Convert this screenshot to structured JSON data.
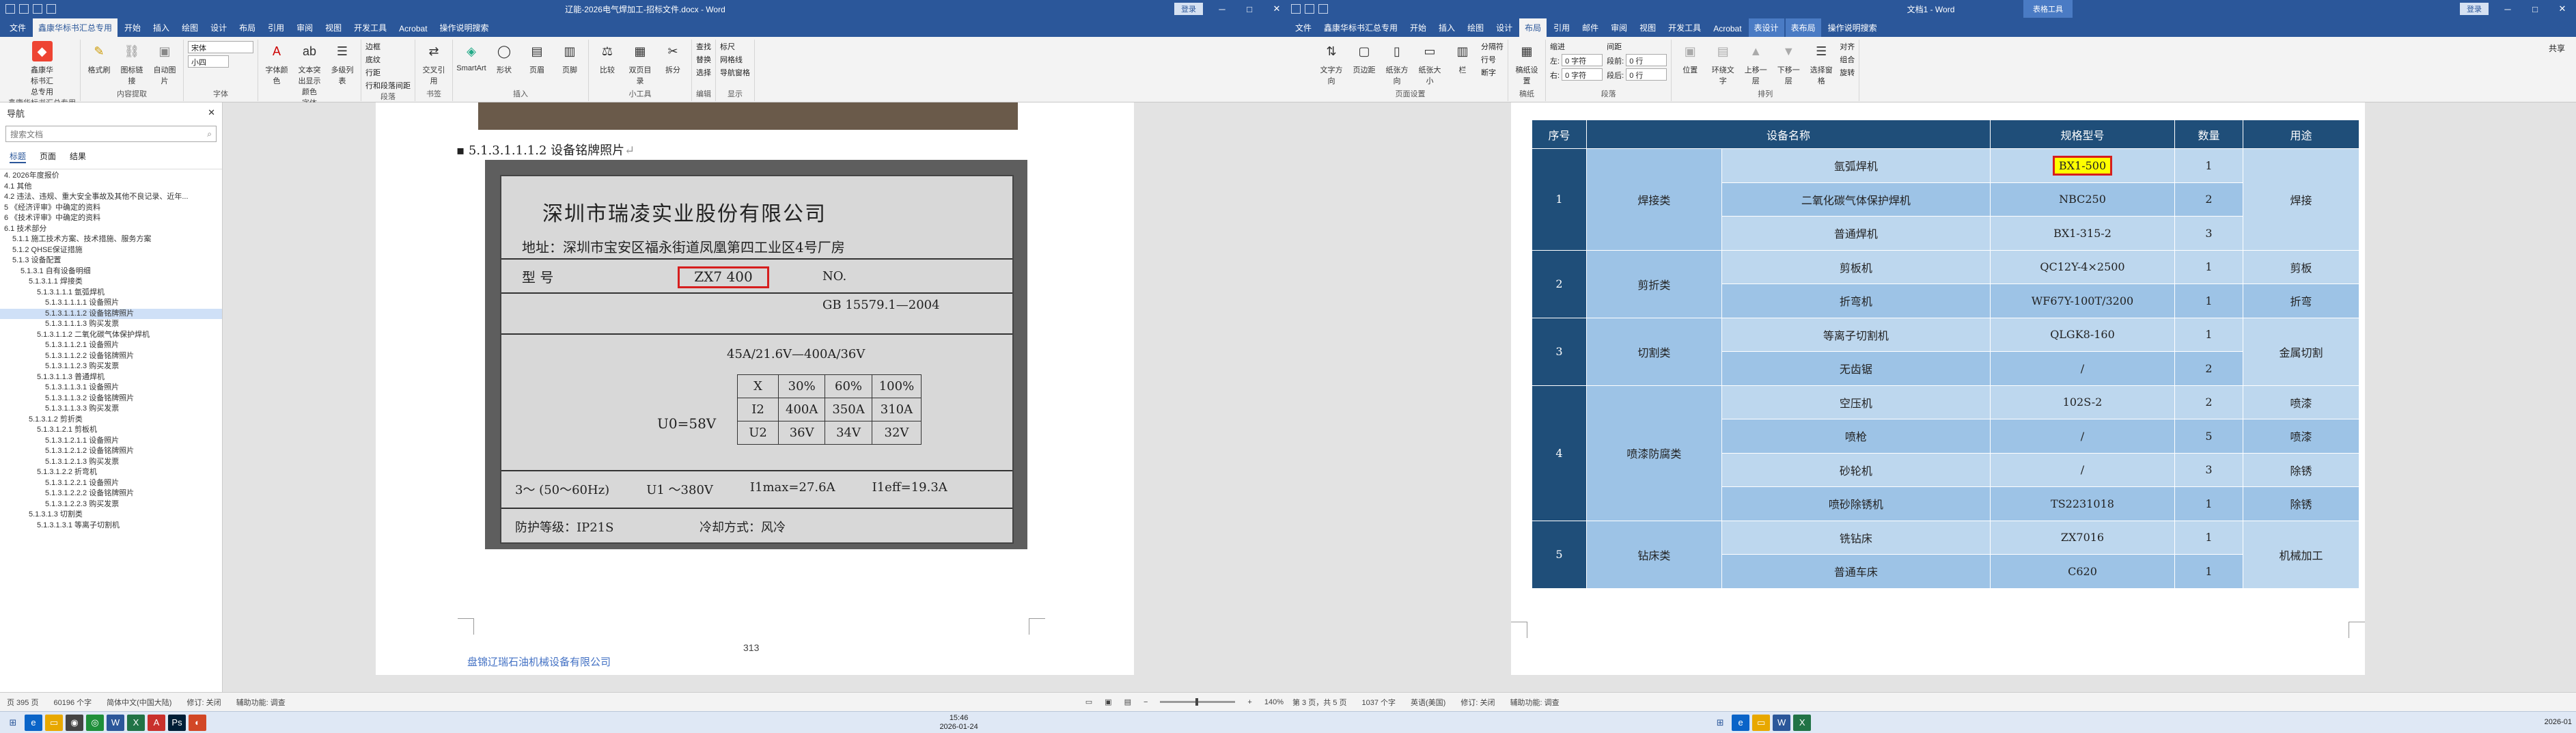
{
  "left_window": {
    "title": "辽能-2026电气焊加工-招标文件.docx - Word",
    "login": "登录",
    "tabs": [
      "文件",
      "鑫康华标书汇总专用",
      "开始",
      "插入",
      "绘图",
      "设计",
      "布局",
      "引用",
      "审阅",
      "视图",
      "开发工具",
      "Acrobat",
      "操作说明搜索"
    ],
    "active_tab": "鑫康华标书汇总专用",
    "ribbon": {
      "groups": [
        {
          "label": "鑫康华标书汇总专用",
          "items": [
            "鑫康华标书汇总专用"
          ]
        },
        {
          "label": "内容提取",
          "items": [
            "格式刷",
            "图标链接",
            "自动图片"
          ]
        },
        {
          "label": "字体",
          "font": "宋体",
          "size": "小四"
        },
        {
          "label": "字体",
          "items": [
            "字体颜色",
            "文本突出显示颜色",
            "多级列表"
          ]
        },
        {
          "label": "段落",
          "items": [
            "边框",
            "底纹",
            "行距",
            "行和段落间距"
          ]
        },
        {
          "label": "书签",
          "items": [
            "交叉引用"
          ]
        },
        {
          "label": "插入",
          "items": [
            "SmartArt",
            "形状",
            "页眉",
            "页脚"
          ]
        },
        {
          "label": "小工具",
          "items": [
            "比较",
            "双页目录",
            "拆分"
          ]
        },
        {
          "label": "编辑",
          "items": [
            "查找",
            "替换",
            "选择"
          ]
        },
        {
          "label": "显示",
          "items": [
            "标尺",
            "网格线",
            "导航窗格"
          ]
        }
      ]
    },
    "nav": {
      "title": "导航",
      "search_placeholder": "搜索文档",
      "tabs": [
        "标题",
        "页面",
        "结果"
      ],
      "items": [
        "4. 2026年度报价",
        "4.1 其他",
        "4.2 违法、违规、重大安全事故及其他不良记录、近年...",
        "5 《经济评审》中确定的资料",
        "6 《技术评审》中确定的资料",
        "6.1 技术部分",
        "5.1.1 施工技术方案、技术措施、服务方案",
        "5.1.2 QHSE保证措施",
        "5.1.3 设备配置",
        "5.1.3.1 自有设备明细",
        "5.1.3.1.1 焊接类",
        "5.1.3.1.1.1 氩弧焊机",
        "5.1.3.1.1.1.1 设备照片",
        "5.1.3.1.1.1.2 设备铭牌照片",
        "5.1.3.1.1.1.3 购买发票",
        "5.1.3.1.1.2 二氧化碳气体保护焊机",
        "5.1.3.1.1.2.1 设备照片",
        "5.1.3.1.1.2.2 设备铭牌照片",
        "5.1.3.1.1.2.3 购买发票",
        "5.1.3.1.1.3 普通焊机",
        "5.1.3.1.1.3.1 设备照片",
        "5.1.3.1.1.3.2 设备铭牌照片",
        "5.1.3.1.1.3.3 购买发票",
        "5.1.3.1.2 剪折类",
        "5.1.3.1.2.1 剪板机",
        "5.1.3.1.2.1.1 设备照片",
        "5.1.3.1.2.1.2 设备铭牌照片",
        "5.1.3.1.2.1.3 购买发票",
        "5.1.3.1.2.2 折弯机",
        "5.1.3.1.2.2.1 设备照片",
        "5.1.3.1.2.2.2 设备铭牌照片",
        "5.1.3.1.2.2.3 购买发票",
        "5.1.3.1.3 切割类",
        "5.1.3.1.3.1 等离子切割机"
      ],
      "selected_index": 13
    },
    "page": {
      "caption": "5.1.3.1.1.1.2 设备铭牌照片",
      "plate": {
        "company": "深圳市瑞凌实业股份有限公司",
        "address": "地址：深圳市宝安区福永街道凤凰第四工业区4号厂房",
        "model_label": "型  号",
        "model": "ZX7 400",
        "no": "NO.",
        "standard": "GB 15579.1—2004",
        "spec": "45A/21.6V—400A/36V",
        "rows": [
          [
            "X",
            "30%",
            "60%",
            "100%"
          ],
          [
            "I2",
            "400A",
            "350A",
            "310A"
          ],
          [
            "U2",
            "36V",
            "34V",
            "32V"
          ]
        ],
        "u0": "U0=58V",
        "supply": "3～ (50～60Hz)",
        "u1": "U1 ～380V",
        "i1max": "I1max=27.6A",
        "i1eff": "I1eff=19.3A",
        "protection": "防护等级：IP21S",
        "cooling": "冷却方式：风冷"
      },
      "footer": "盘锦辽瑞石油机械设备有限公司",
      "page_number": "313"
    },
    "status": {
      "page": "页 395 页",
      "words": "60196 个字",
      "lang": "简体中文(中国大陆)",
      "revision": "修订: 关闭",
      "access": "辅助功能: 调查",
      "zoom": "140%"
    }
  },
  "right_window": {
    "title": "文档1 - Word",
    "context_tab": "表格工具",
    "login": "登录",
    "share": "共享",
    "tabs": [
      "文件",
      "鑫康华标书汇总专用",
      "开始",
      "插入",
      "绘图",
      "设计",
      "布局",
      "引用",
      "邮件",
      "审阅",
      "视图",
      "开发工具",
      "Acrobat",
      "表设计",
      "表布局",
      "操作说明搜索"
    ],
    "active_tab": "布局",
    "ribbon": {
      "groups": [
        {
          "label": "页面设置",
          "items": [
            "文字方向",
            "页边距",
            "纸张方向",
            "纸张大小",
            "栏",
            "分隔符",
            "行号",
            "断字"
          ]
        },
        {
          "label": "稿纸",
          "items": [
            "稿纸设置"
          ]
        },
        {
          "label": "段落",
          "indent_left": "0 字符",
          "indent_right": "0 字符",
          "space_before": "0 行",
          "space_after": "0 行"
        },
        {
          "label": "排列",
          "items": [
            "位置",
            "环绕文字",
            "上移一层",
            "下移一层",
            "选择窗格",
            "对齐",
            "组合",
            "旋转"
          ]
        }
      ]
    },
    "table": {
      "headers": [
        "序号",
        "设备名称",
        "规格型号",
        "数量",
        "用途"
      ],
      "groups": [
        {
          "no": "1",
          "category": "焊接类",
          "purpose": "焊接",
          "rows": [
            [
              "氩弧焊机",
              "BX1-500",
              "1"
            ],
            [
              "二氧化碳气体保护焊机",
              "NBC250",
              "2"
            ],
            [
              "普通焊机",
              "BX1-315-2",
              "3"
            ]
          ]
        },
        {
          "no": "2",
          "category": "剪折类",
          "rows": [
            [
              "剪板机",
              "QC12Y-4×2500",
              "1",
              "剪板"
            ],
            [
              "折弯机",
              "WF67Y-100T/3200",
              "1",
              "折弯"
            ]
          ]
        },
        {
          "no": "3",
          "category": "切割类",
          "purpose": "金属切割",
          "rows": [
            [
              "等离子切割机",
              "QLGK8-160",
              "1"
            ],
            [
              "无齿锯",
              "/",
              "2"
            ]
          ]
        },
        {
          "no": "4",
          "category": "喷漆防腐类",
          "rows": [
            [
              "空压机",
              "102S-2",
              "2",
              "喷漆"
            ],
            [
              "喷枪",
              "/",
              "5",
              "喷漆"
            ],
            [
              "砂轮机",
              "/",
              "3",
              "除锈"
            ],
            [
              "喷砂除锈机",
              "TS2231018",
              "1",
              "除锈"
            ]
          ]
        },
        {
          "no": "5",
          "category": "钻床类",
          "purpose": "机械加工",
          "rows": [
            [
              "铣钻床",
              "ZX7016",
              "1"
            ],
            [
              "普通车床",
              "C620",
              "1"
            ]
          ]
        }
      ]
    },
    "status": {
      "page": "第 3 页，共 5 页",
      "words": "1037 个字",
      "lang": "英语(美国)",
      "revision": "修订: 关闭",
      "access": "辅助功能: 调查"
    }
  },
  "taskbar": {
    "time": "15:46",
    "date": "2026-01-24",
    "right_clip": "2026-01"
  }
}
